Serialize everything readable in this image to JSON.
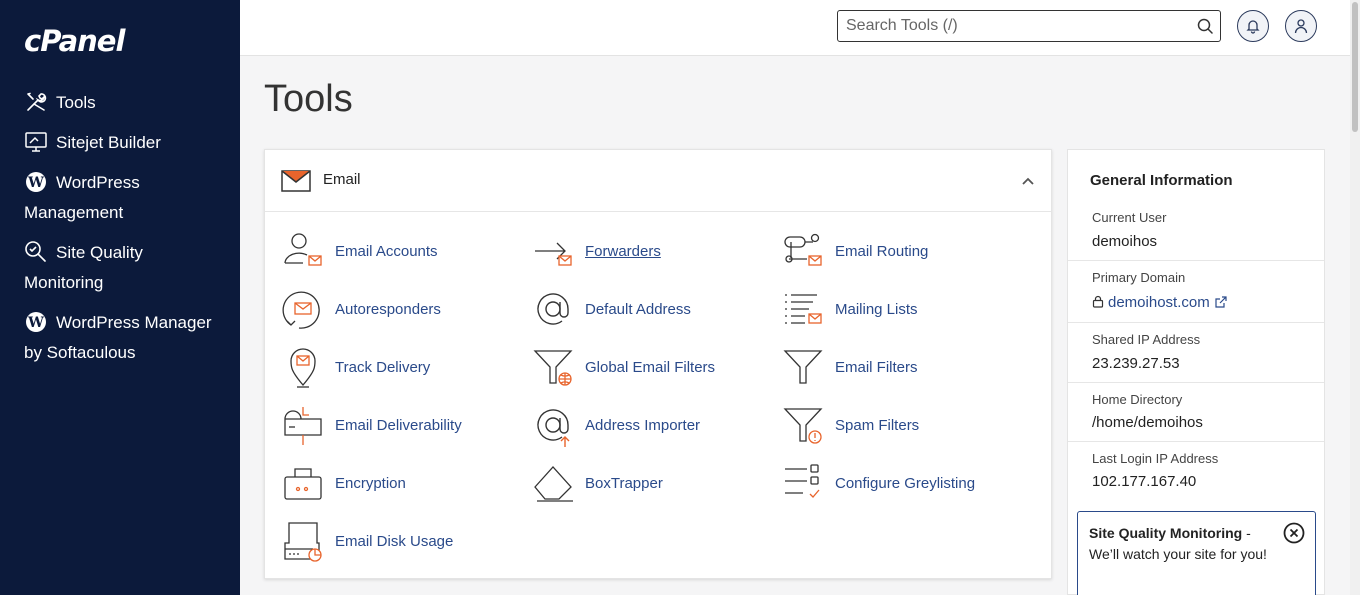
{
  "app": {
    "logo": "cPanel"
  },
  "sidebar": {
    "items": [
      {
        "label": "Tools",
        "icon": "tools-icon"
      },
      {
        "label": "Sitejet Builder",
        "icon": "monitor-icon"
      },
      {
        "label": "WordPress Management",
        "icon": "wordpress-icon"
      },
      {
        "label": "Site Quality Monitoring",
        "icon": "magnifier-icon"
      },
      {
        "label": "WordPress Manager by Softaculous",
        "icon": "wordpress-icon"
      }
    ]
  },
  "header": {
    "search_placeholder": "Search Tools (/)",
    "search_icon": "search-icon",
    "notifications_icon": "bell-icon",
    "user_icon": "user-icon"
  },
  "page": {
    "title": "Tools"
  },
  "email_panel": {
    "title": "Email",
    "collapse_icon": "chevron-up-icon",
    "tools": [
      {
        "label": "Email Accounts",
        "icon": "email-accounts-icon"
      },
      {
        "label": "Forwarders",
        "icon": "forwarders-icon"
      },
      {
        "label": "Email Routing",
        "icon": "email-routing-icon"
      },
      {
        "label": "Autoresponders",
        "icon": "autoresponders-icon"
      },
      {
        "label": "Default Address",
        "icon": "at-sign-icon"
      },
      {
        "label": "Mailing Lists",
        "icon": "mailing-lists-icon"
      },
      {
        "label": "Track Delivery",
        "icon": "track-delivery-icon"
      },
      {
        "label": "Global Email Filters",
        "icon": "global-filter-icon"
      },
      {
        "label": "Email Filters",
        "icon": "filter-icon"
      },
      {
        "label": "Email Deliverability",
        "icon": "mailbox-icon"
      },
      {
        "label": "Address Importer",
        "icon": "address-importer-icon"
      },
      {
        "label": "Spam Filters",
        "icon": "spam-filter-icon"
      },
      {
        "label": "Encryption",
        "icon": "encryption-icon"
      },
      {
        "label": "BoxTrapper",
        "icon": "boxtrapper-icon"
      },
      {
        "label": "Configure Greylisting",
        "icon": "greylisting-icon"
      },
      {
        "label": "Email Disk Usage",
        "icon": "disk-usage-icon"
      }
    ]
  },
  "general_info": {
    "title": "General Information",
    "current_user_label": "Current User",
    "current_user": "demoihos",
    "primary_domain_label": "Primary Domain",
    "primary_domain": "demoihost.com",
    "shared_ip_label": "Shared IP Address",
    "shared_ip": "23.239.27.53",
    "home_dir_label": "Home Directory",
    "home_dir": "/home/demoihos",
    "last_login_label": "Last Login IP Address",
    "last_login_ip": "102.177.167.40"
  },
  "sqm_banner": {
    "title": "Site Quality Monitoring",
    "text": " - We’ll watch your site for you!"
  },
  "colors": {
    "sidebar_bg": "#0c1a3b",
    "link": "#2a4a8a",
    "accent": "#e8642c"
  }
}
